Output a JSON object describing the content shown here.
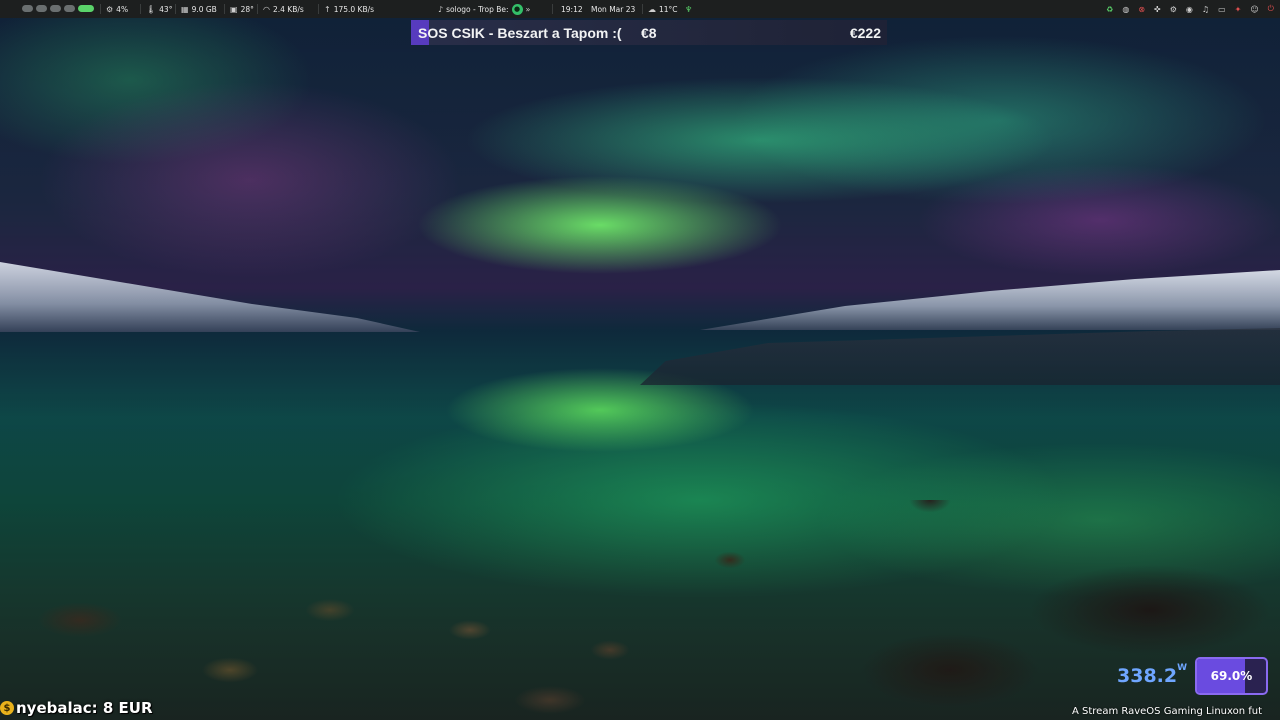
{
  "topbar": {
    "cpu": "4%",
    "cpu_temp": "43°",
    "memory": "9.0 GB",
    "gpu_temp": "28°",
    "net_down": "2.4 KB/s",
    "net_up": "175.0 KB/s",
    "media_title": "sologo - Trop Be:",
    "time": "19:12",
    "date": "Mon Mar 23",
    "weather": "11°C"
  },
  "alert": {
    "title": "SOS CSIK - Beszart a Tapom :(",
    "amount": "€8",
    "total": "€222"
  },
  "donor": {
    "text": "nyebalac: 8 EUR"
  },
  "power": {
    "value": "338.2",
    "unit": "W"
  },
  "gauge": {
    "label": "69.0%",
    "fraction": 0.69
  },
  "ticker": {
    "text": "A Stream RaveOS Gaming Linuxon fut"
  },
  "colors": {
    "accent": "#5b3dc6",
    "workspace_active": "#5ad36a",
    "power_text": "#6fa6ff",
    "gauge_border": "#8a6af0"
  }
}
